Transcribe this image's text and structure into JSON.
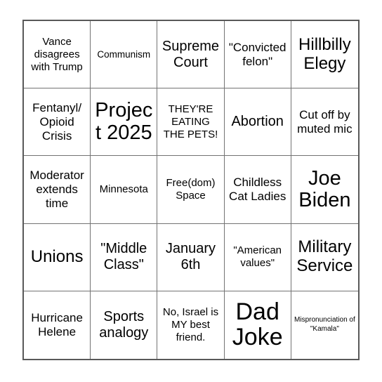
{
  "card": {
    "type": "bingo-card",
    "rows": 5,
    "columns": 5,
    "border_color": "#595959",
    "grid_line_color": "#737373",
    "background_color": "#ffffff",
    "text_color": "#000000"
  },
  "cells": [
    {
      "text": "Vance disagrees with Trump",
      "size": "s"
    },
    {
      "text": "Communism",
      "size": "xs"
    },
    {
      "text": "Supreme Court",
      "size": "l"
    },
    {
      "text": "\"Convicted felon\"",
      "size": "m"
    },
    {
      "text": "Hillbilly Elegy",
      "size": "xl"
    },
    {
      "text": "Fentanyl/ Opioid Crisis",
      "size": "m"
    },
    {
      "text": "Project 2025",
      "size": "xxl"
    },
    {
      "text": "THEY'RE EATING THE PETS!",
      "size": "s"
    },
    {
      "text": "Abortion",
      "size": "l"
    },
    {
      "text": "Cut off by muted mic",
      "size": "m"
    },
    {
      "text": "Moderator extends time",
      "size": "m"
    },
    {
      "text": "Minnesota",
      "size": "s"
    },
    {
      "text": "Free(dom) Space",
      "size": "s"
    },
    {
      "text": "Childless Cat Ladies",
      "size": "m"
    },
    {
      "text": "Joe Biden",
      "size": "xxl"
    },
    {
      "text": "Unions",
      "size": "xl"
    },
    {
      "text": "\"Middle Class\"",
      "size": "l"
    },
    {
      "text": "January 6th",
      "size": "l"
    },
    {
      "text": "\"American values\"",
      "size": "s"
    },
    {
      "text": "Military Service",
      "size": "xl"
    },
    {
      "text": "Hurricane Helene",
      "size": "m"
    },
    {
      "text": "Sports analogy",
      "size": "l"
    },
    {
      "text": "No, Israel is MY best friend.",
      "size": "s"
    },
    {
      "text": "Dad Joke",
      "size": "3xl"
    },
    {
      "text": "Mispronunciation of \"Kamala\"",
      "size": "xxs"
    }
  ]
}
